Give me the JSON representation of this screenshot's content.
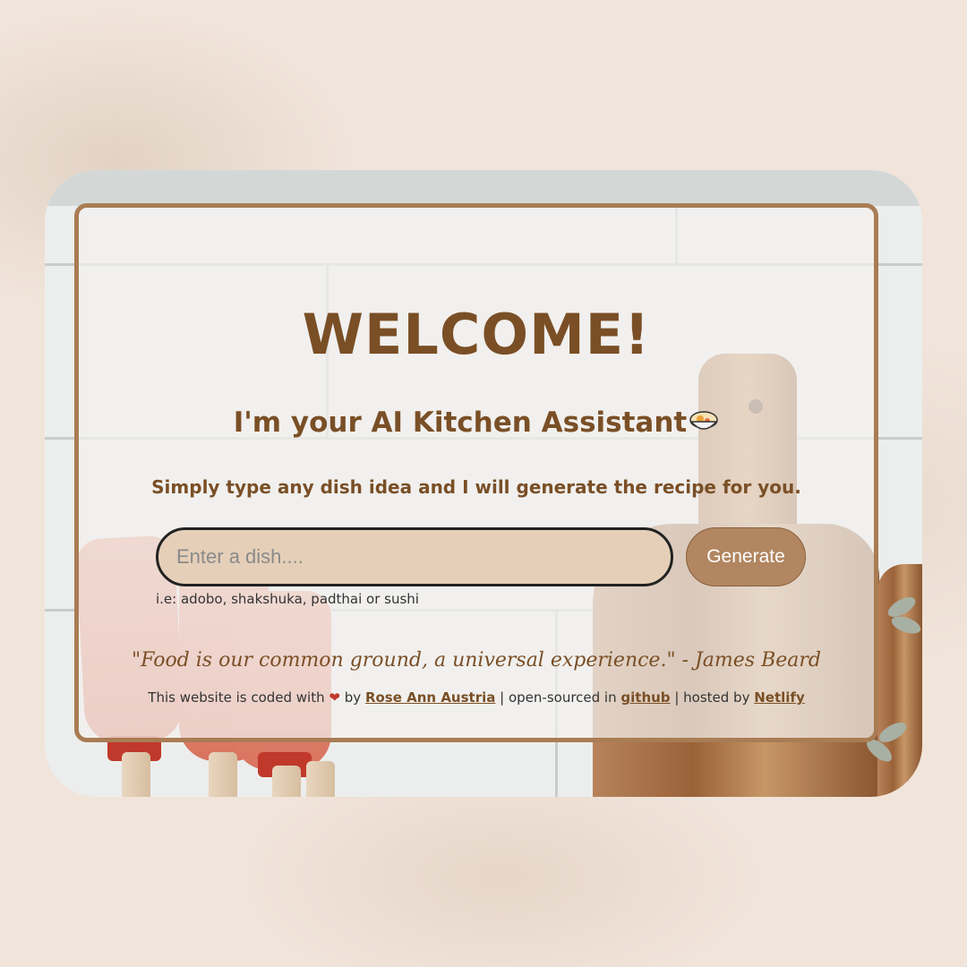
{
  "header": {
    "welcome": "WELCOME!",
    "subtitle": "I'm your AI Kitchen Assistant",
    "subtitle_icon": "bowl-icon",
    "tagline": "Simply type any dish idea and I will generate the recipe for you."
  },
  "form": {
    "placeholder": "Enter a dish....",
    "value": "",
    "button_label": "Generate",
    "hint": "i.e: adobo, shakshuka, padthai or sushi"
  },
  "quote": "\"Food is our common ground, a universal experience.\" - James Beard",
  "footer": {
    "prefix": "This website is coded with",
    "heart_icon": "heart-icon",
    "by": "by",
    "author": "Rose Ann Austria",
    "sep1": "| open-sourced in",
    "github": "github",
    "sep2": "| hosted by",
    "host": "Netlify"
  },
  "colors": {
    "accent": "#7a4f26",
    "border": "#a97c54",
    "button": "#b18660",
    "input_bg": "#e5cfb8"
  }
}
